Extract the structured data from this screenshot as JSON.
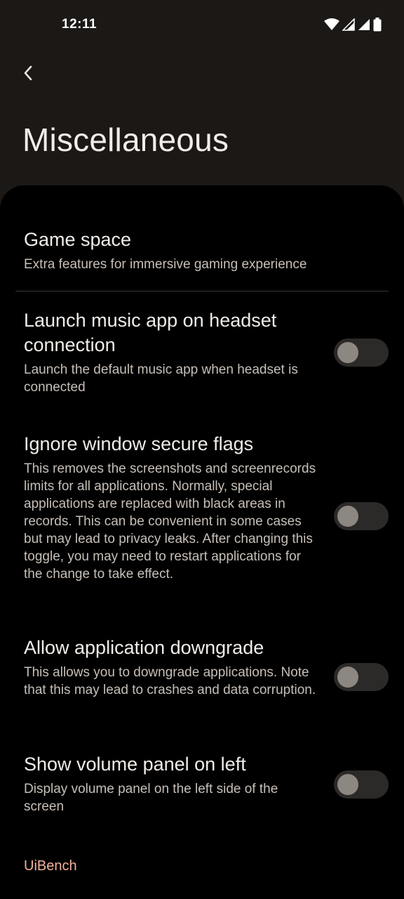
{
  "status_bar": {
    "time": "12:11",
    "icons": [
      "wifi-icon",
      "signal-icon",
      "signal-icon",
      "battery-icon"
    ]
  },
  "header": {
    "back_icon": "chevron-left-icon",
    "title": "Miscellaneous"
  },
  "preferences": [
    {
      "title": "Game space",
      "summary": "Extra features for immersive gaming experience",
      "has_toggle": false
    },
    {
      "title": "Launch music app on headset connection",
      "summary": "Launch the default music app when headset is connected",
      "has_toggle": true,
      "enabled": false
    },
    {
      "title": "Ignore window secure flags",
      "summary": "This removes the screenshots and screenrecords limits for all applications. Normally, special applications are replaced with black areas in records. This can be convenient in some cases but may lead to privacy leaks. After changing this toggle, you may need to restart applications for the change to take effect.",
      "has_toggle": true,
      "enabled": false
    },
    {
      "title": "Allow application downgrade",
      "summary": "This allows you to downgrade applications. Note that this may lead to crashes and data corruption.",
      "has_toggle": true,
      "enabled": false
    },
    {
      "title": "Show volume panel on left",
      "summary": "Display volume panel on the left side of the screen",
      "has_toggle": true,
      "enabled": false
    }
  ],
  "footer": {
    "label": "UiBench"
  },
  "colors": {
    "background": "#1b1816",
    "sheet": "#000000",
    "accent": "#f2b39a",
    "toggle_track_off": "#2c2a28",
    "toggle_thumb_off": "#8d8782"
  }
}
